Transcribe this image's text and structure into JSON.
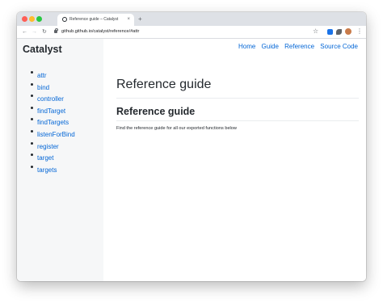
{
  "browser": {
    "tab": {
      "title": "Reference guide – Catalyst",
      "close_glyph": "×"
    },
    "new_tab_glyph": "+",
    "nav": {
      "back_glyph": "←",
      "forward_glyph": "→",
      "reload_glyph": "↻"
    },
    "url": "github.github.io/catalyst/reference/#attr",
    "toolbar_icons": [
      "star-icon",
      "extension-icon",
      "puzzle-icon",
      "avatar",
      "menu-icon"
    ],
    "star_glyph": "☆",
    "menu_glyph": "⋮"
  },
  "site": {
    "title": "Catalyst"
  },
  "topnav": [
    "Home",
    "Guide",
    "Reference",
    "Source Code"
  ],
  "sidebar": {
    "items": [
      "attr",
      "bind",
      "controller",
      "findTarget",
      "findTargets",
      "listenForBind",
      "register",
      "target",
      "targets"
    ]
  },
  "main": {
    "h1": "Reference guide",
    "h2": "Reference guide",
    "paragraph": "Find the reference guide for all our exported functions below"
  },
  "colors": {
    "link": "#0366d6",
    "text": "#24292e",
    "sidebar_bg": "#f6f7f8",
    "tabbar_bg": "#dee1e6"
  }
}
